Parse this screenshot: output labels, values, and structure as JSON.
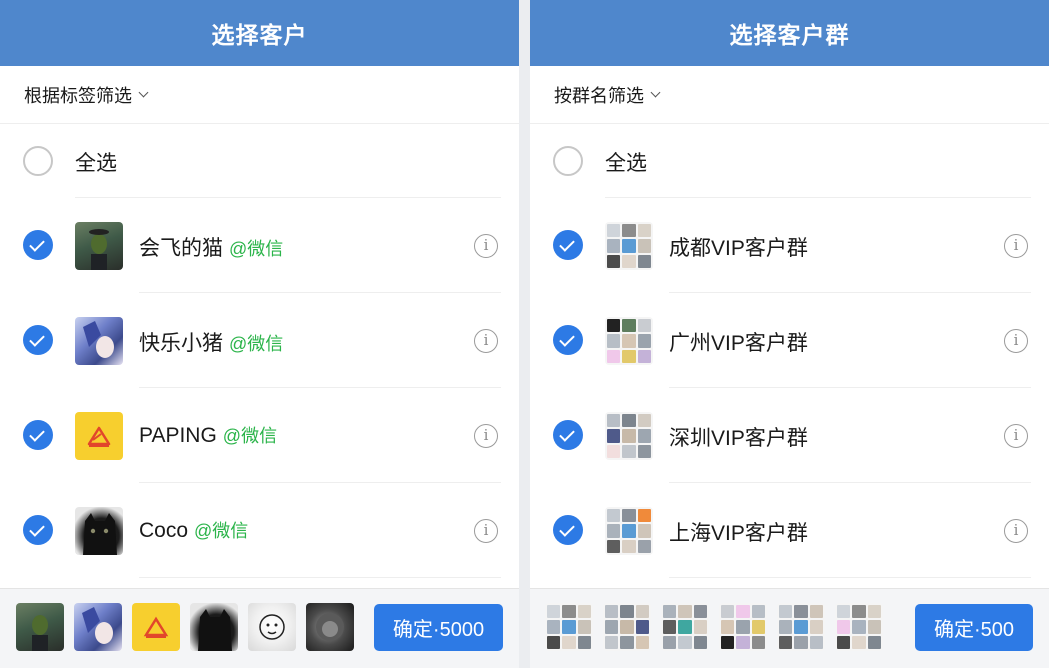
{
  "left": {
    "title": "选择客户",
    "filter_label": "根据标签筛选",
    "select_all_label": "全选",
    "items": [
      {
        "name": "会飞的猫",
        "tag": "@微信",
        "avatar": "painting-avatar"
      },
      {
        "name": "快乐小猪",
        "tag": "@微信",
        "avatar": "anime-avatar"
      },
      {
        "name": "PAPING",
        "tag": "@微信",
        "avatar": "paping-logo-avatar"
      },
      {
        "name": "Coco",
        "tag": "@微信",
        "avatar": "black-cat-avatar"
      }
    ],
    "confirm_label": "确定·5000"
  },
  "right": {
    "title": "选择客户群",
    "filter_label": "按群名筛选",
    "select_all_label": "全选",
    "items": [
      {
        "name": "成都VIP客户群"
      },
      {
        "name": "广州VIP客户群"
      },
      {
        "name": "深圳VIP客户群"
      },
      {
        "name": "上海VIP客户群"
      }
    ],
    "confirm_label": "确定·500"
  },
  "colors": {
    "header_bg": "#4f87cc",
    "accent_blue": "#2d7ae5",
    "wechat_green": "#2bb44a"
  },
  "icons": {
    "checked": "check-circle-icon",
    "unchecked": "empty-circle-icon",
    "info": "info-icon",
    "dropdown": "chevron-down-icon"
  }
}
